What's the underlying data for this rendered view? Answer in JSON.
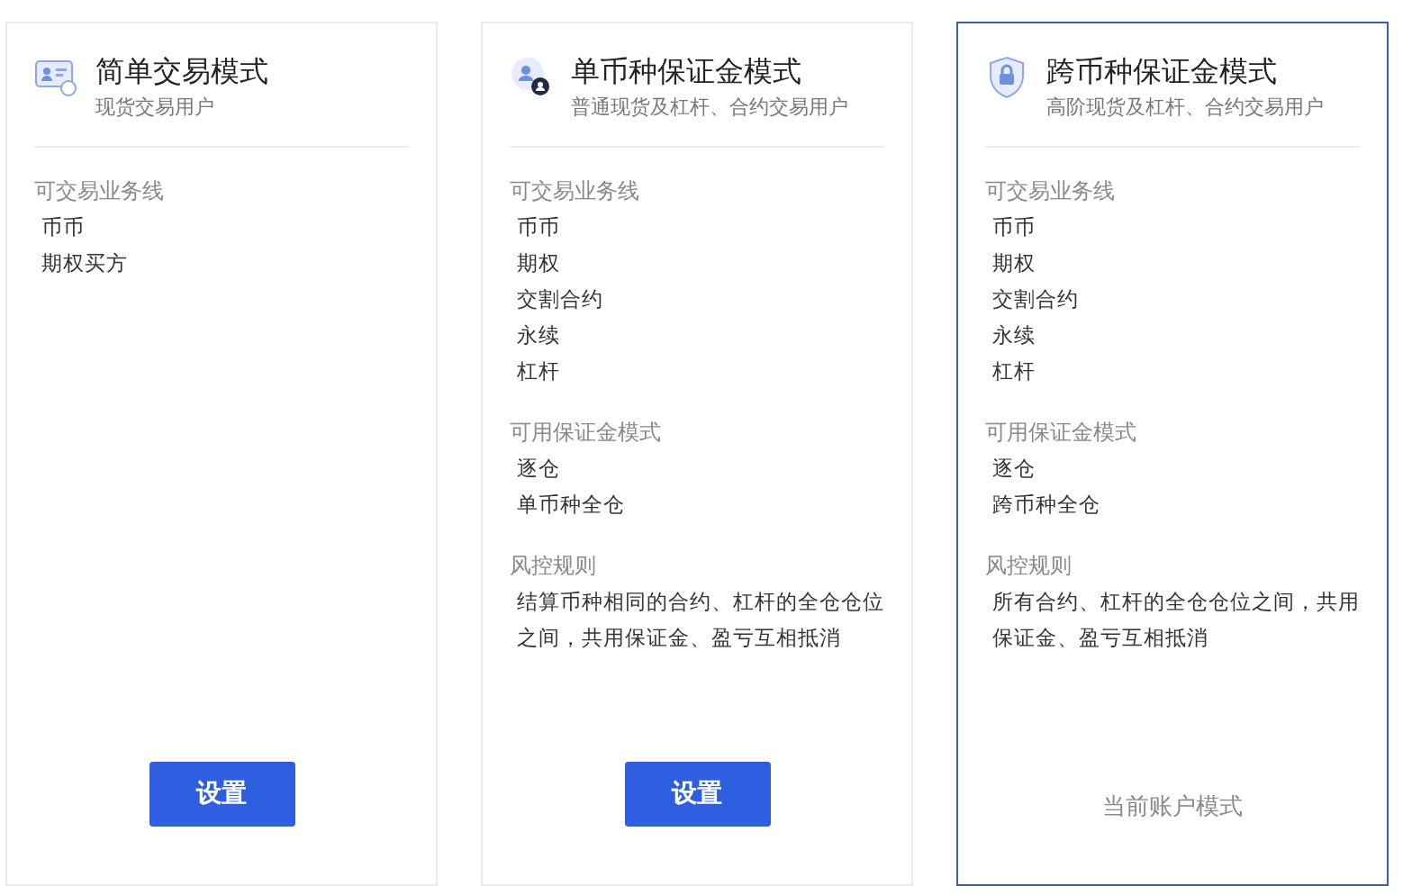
{
  "cards": [
    {
      "title": "简单交易模式",
      "subtitle": "现货交易用户",
      "selected": false,
      "sections": [
        {
          "label": "可交易业务线",
          "items": [
            "币币",
            "期权买方"
          ]
        }
      ],
      "action": {
        "kind": "button",
        "label": "设置"
      }
    },
    {
      "title": "单币种保证金模式",
      "subtitle": "普通现货及杠杆、合约交易用户",
      "selected": false,
      "sections": [
        {
          "label": "可交易业务线",
          "items": [
            "币币",
            "期权",
            "交割合约",
            "永续",
            "杠杆"
          ]
        },
        {
          "label": "可用保证金模式",
          "items": [
            "逐仓",
            "单币种全仓"
          ]
        },
        {
          "label": "风控规则",
          "items": [
            "结算币种相同的合约、杠杆的全仓仓位之间，共用保证金、盈亏互相抵消"
          ]
        }
      ],
      "action": {
        "kind": "button",
        "label": "设置"
      }
    },
    {
      "title": "跨币种保证金模式",
      "subtitle": "高阶现货及杠杆、合约交易用户",
      "selected": true,
      "sections": [
        {
          "label": "可交易业务线",
          "items": [
            "币币",
            "期权",
            "交割合约",
            "永续",
            "杠杆"
          ]
        },
        {
          "label": "可用保证金模式",
          "items": [
            "逐仓",
            "跨币种全仓"
          ]
        },
        {
          "label": "风控规则",
          "items": [
            "所有合约、杠杆的全仓仓位之间，共用保证金、盈亏互相抵消"
          ]
        }
      ],
      "action": {
        "kind": "status",
        "label": "当前账户模式"
      }
    }
  ]
}
